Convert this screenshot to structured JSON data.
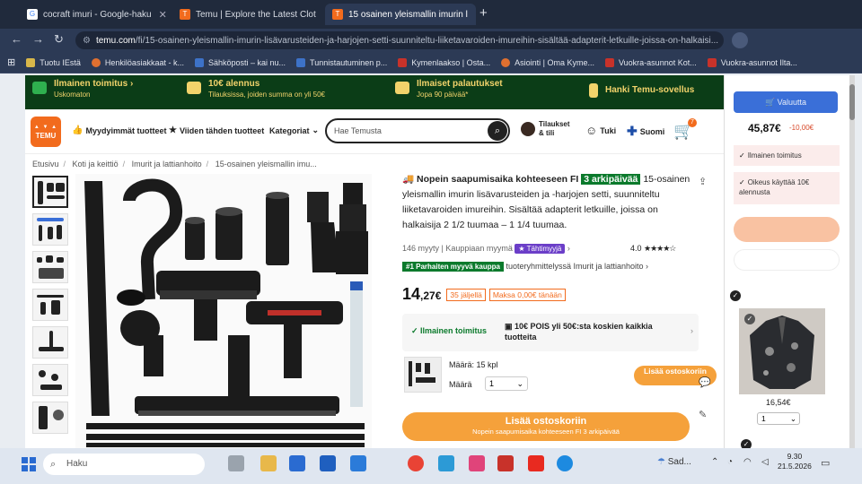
{
  "browser": {
    "tabs": [
      {
        "label": "cocraft imuri - Google-haku",
        "icon": "google-icon",
        "color": "#ffffff"
      },
      {
        "label": "Temu | Explore the Latest Clot",
        "icon": "temu-icon",
        "color": "#f26b1d"
      },
      {
        "label": "15 osainen yleismallin imurin l",
        "icon": "temu-icon",
        "color": "#f26b1d"
      }
    ],
    "new_tab": "+",
    "url_host": "temu.com",
    "url_path": "/fi/15-osainen-yleismallin-imurin-lisävarusteiden-ja-harjojen-setti-suunniteltu-liiketavaroiden-imureihin-sisältää-adapterit-letkuille-joissa-on-halkaisi..."
  },
  "bookmarks": [
    {
      "label": "Tuotu IEstä",
      "icon": "folder-icon"
    },
    {
      "label": "Henkilöasiakkaat - k...",
      "icon": "bank-icon"
    },
    {
      "label": "Sähköposti – kai nu...",
      "icon": "mail-icon"
    },
    {
      "label": "Tunnistautuminen p...",
      "icon": "id-icon"
    },
    {
      "label": "Kymenlaakso | Osta...",
      "icon": "shop-icon"
    },
    {
      "label": "Asiointi | Oma Kyme...",
      "icon": "gear-icon"
    },
    {
      "label": "Vuokra-asunnot Kot...",
      "icon": "home-icon"
    },
    {
      "label": "Vuokra-asunnot Ilta...",
      "icon": "home-icon"
    }
  ],
  "promo": [
    {
      "title": "Ilmainen toimitus ›",
      "sub": "Uskomaton",
      "icon": "truck-icon"
    },
    {
      "title": "10€ alennus",
      "sub": "Tilauksissa, joiden summa on yli 50€",
      "icon": "coupon-icon"
    },
    {
      "title": "Ilmaiset palautukset",
      "sub": "Jopa 90 päivää*",
      "icon": "return-icon"
    },
    {
      "title": "Hanki Temu-sovellus",
      "sub": "",
      "icon": "phone-icon"
    }
  ],
  "header": {
    "logo": "TEMU",
    "links": [
      "Myydyimmät tuotteet",
      "Viiden tähden tuotteet",
      "Kategoriat"
    ],
    "search_placeholder": "Hae Temusta",
    "account": "Tilaukset & tili",
    "support": "Tuki",
    "language": "Suomi",
    "cart_count": "7"
  },
  "breadcrumb": [
    "Etusivu",
    "Koti ja keittiö",
    "Imurit ja lattianhoito",
    "15-osainen yleismallin imu..."
  ],
  "product": {
    "arrival_label": "Nopein saapumisaika kohteeseen FI",
    "arrival_days": "3 arkipäivää",
    "title": "15-osainen yleismallin imurin lisävarusteiden ja -harjojen setti, suunniteltu liiketavaroiden imureihin. Sisältää adapterit letkuille, joissa on halkaisija 2 1/2 tuumaa – 1 1/4 tuumaa.",
    "sold": "146 myyty",
    "seller": "Kauppiaan myymä",
    "seller_badge": "Tähtimyyjä",
    "rating": "4.0",
    "stars": 4,
    "rank_badge": "#1 Parhaiten myyvä kauppa",
    "rank_text": "tuoteryhmittelyssä Imurit ja lattianhoito",
    "price_whole": "14",
    "price_frac": ",27€",
    "stock_badge": "35 jäljellä",
    "pay_badge": "Maksa 0,00€ tänään",
    "shipping_left": "Ilmainen toimitus",
    "shipping_right": "10€ POIS yli 50€:sta koskien kaikkia tuotteita",
    "amount_line": "Määrä: 15 kpl",
    "qty_label": "Määrä",
    "qty_value": "1",
    "small_cart_btn": "Lisää ostoskoriin",
    "big_cart_btn": "Lisää ostoskoriin",
    "big_cart_sub": "Nopein saapumisaika kohteeseen FI 3 arkipäivää"
  },
  "cart_panel": {
    "go_button": "Valuutta",
    "total": "45,87€",
    "saving": "-10,00€",
    "info1": "Ilmainen toimitus",
    "info2": "Oikeus käyttää 10€ alennusta",
    "item_price": "16,54€",
    "item_qty": "1"
  },
  "taskbar": {
    "search": "Haku",
    "weather": "Sad...",
    "time": "9.30",
    "date": "21.5.2026"
  }
}
